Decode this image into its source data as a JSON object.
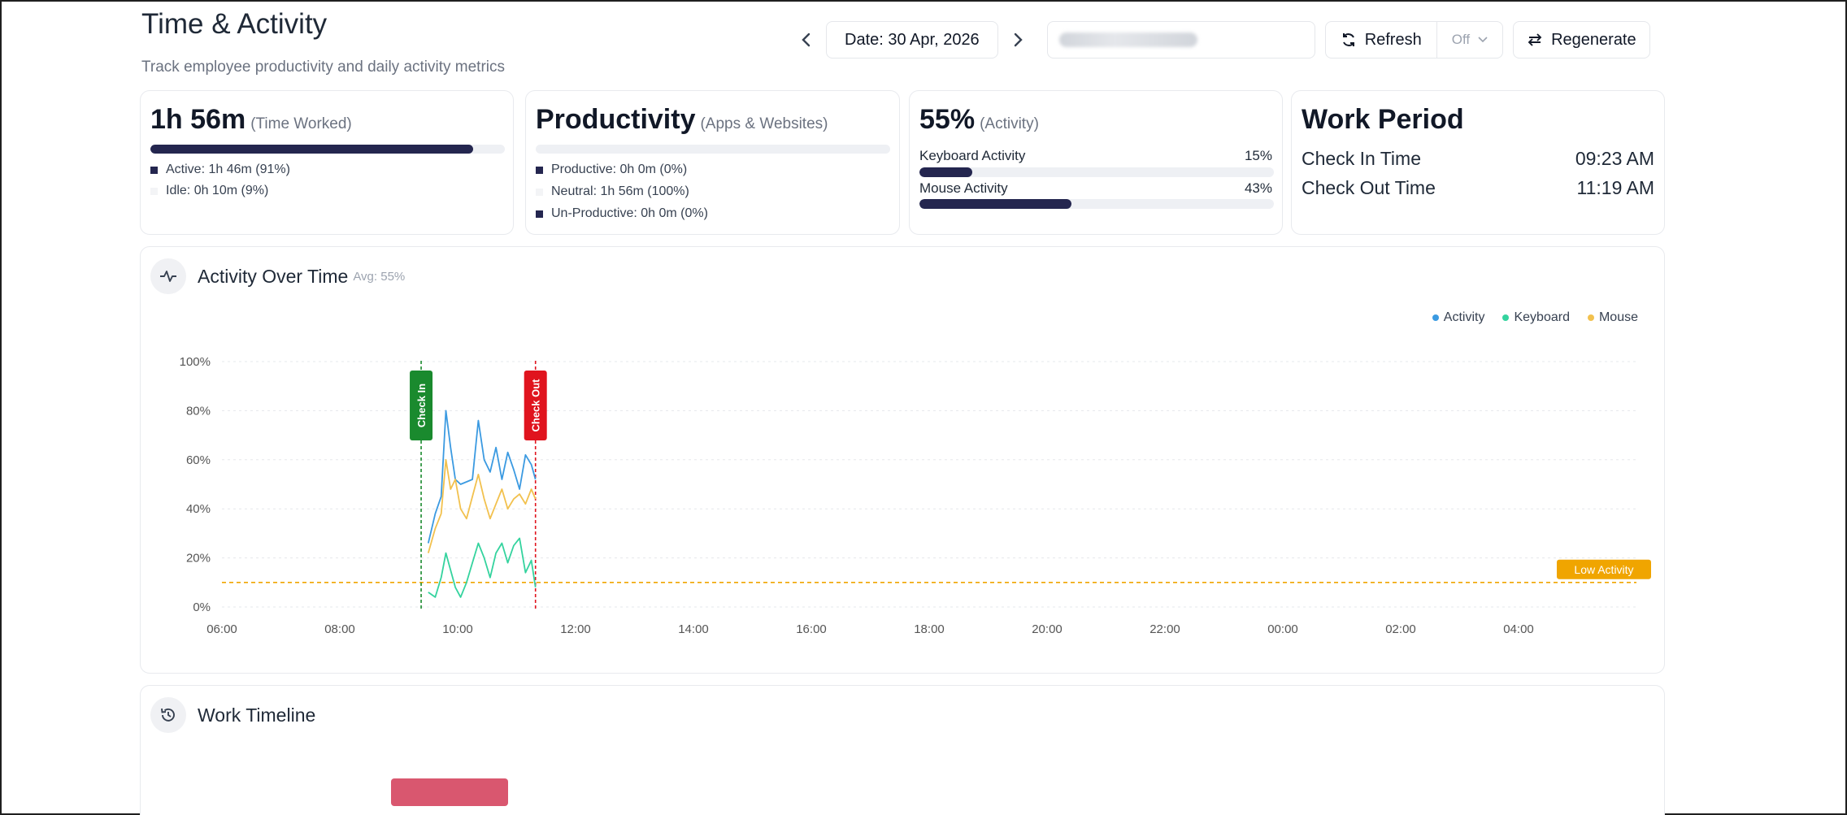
{
  "header": {
    "title": "Time & Activity",
    "subtitle": "Track employee productivity and daily activity metrics"
  },
  "toolbar": {
    "prev_icon": "chevron-left-icon",
    "next_icon": "chevron-right-icon",
    "date_label": "Date: 30 Apr, 2026",
    "refresh_label": "Refresh",
    "auto_refresh_value": "Off",
    "regenerate_label": "Regenerate"
  },
  "time_worked": {
    "value": "1h 56m",
    "label": "(Time Worked)",
    "active_fraction": 0.91,
    "active": "Active: 1h 46m (91%)",
    "idle": "Idle: 0h 10m (9%)"
  },
  "productivity": {
    "title": "Productivity",
    "label": "(Apps & Websites)",
    "productive_fraction": 0,
    "productive": "Productive: 0h 0m (0%)",
    "neutral": "Neutral: 1h 56m (100%)",
    "unproductive": "Un-Productive: 0h 0m (0%)"
  },
  "activity": {
    "value": "55%",
    "label": "(Activity)",
    "keyboard_label": "Keyboard Activity",
    "keyboard_value": "15%",
    "keyboard_fraction": 0.15,
    "mouse_label": "Mouse Activity",
    "mouse_value": "43%",
    "mouse_fraction": 0.43
  },
  "work_period": {
    "title": "Work Period",
    "check_in_label": "Check In Time",
    "check_in_value": "09:23 AM",
    "check_out_label": "Check Out Time",
    "check_out_value": "11:19 AM"
  },
  "activity_section": {
    "title": "Activity Over Time",
    "avg": "Avg: 55%",
    "icon": "pulse-icon"
  },
  "timeline_section": {
    "title": "Work Timeline",
    "icon": "history-icon"
  },
  "chart_data": {
    "type": "line",
    "ylim": [
      0,
      100
    ],
    "y_ticks": [
      "100%",
      "80%",
      "60%",
      "40%",
      "20%",
      "0%"
    ],
    "x_ticks": [
      "06:00",
      "08:00",
      "10:00",
      "12:00",
      "14:00",
      "16:00",
      "18:00",
      "20:00",
      "22:00",
      "00:00",
      "02:00",
      "04:00"
    ],
    "legend": [
      "Activity",
      "Keyboard",
      "Mouse"
    ],
    "colors": {
      "Activity": "#3b9ae1",
      "Keyboard": "#34d39e",
      "Mouse": "#f2c14e",
      "threshold": "#f0a500",
      "check_in": "#1a8a2e",
      "check_out": "#e0141e"
    },
    "check_in_hour": 9.38,
    "check_out_hour": 11.32,
    "check_in_label": "Check In",
    "check_out_label": "Check Out",
    "threshold_value": 10,
    "threshold_label": "Low Activity",
    "series": [
      {
        "name": "Activity",
        "x": [
          9.5,
          9.62,
          9.72,
          9.8,
          9.88,
          9.96,
          10.05,
          10.15,
          10.25,
          10.35,
          10.45,
          10.55,
          10.65,
          10.75,
          10.85,
          10.95,
          11.05,
          11.15,
          11.25,
          11.32
        ],
        "values": [
          26,
          38,
          45,
          80,
          65,
          52,
          50,
          51,
          52,
          76,
          60,
          55,
          65,
          52,
          63,
          56,
          48,
          62,
          58,
          52
        ]
      },
      {
        "name": "Keyboard",
        "x": [
          9.5,
          9.62,
          9.72,
          9.8,
          9.88,
          9.96,
          10.05,
          10.15,
          10.25,
          10.35,
          10.45,
          10.55,
          10.65,
          10.75,
          10.85,
          10.95,
          11.05,
          11.15,
          11.25,
          11.32
        ],
        "values": [
          6,
          4,
          12,
          22,
          15,
          8,
          4,
          10,
          18,
          26,
          20,
          12,
          22,
          26,
          18,
          25,
          28,
          14,
          19,
          8
        ]
      },
      {
        "name": "Mouse",
        "x": [
          9.5,
          9.62,
          9.72,
          9.8,
          9.88,
          9.96,
          10.05,
          10.15,
          10.25,
          10.35,
          10.45,
          10.55,
          10.65,
          10.75,
          10.85,
          10.95,
          11.05,
          11.15,
          11.25,
          11.32
        ],
        "values": [
          22,
          32,
          38,
          60,
          48,
          52,
          40,
          36,
          45,
          54,
          44,
          36,
          42,
          48,
          40,
          44,
          46,
          42,
          48,
          44
        ]
      }
    ]
  }
}
